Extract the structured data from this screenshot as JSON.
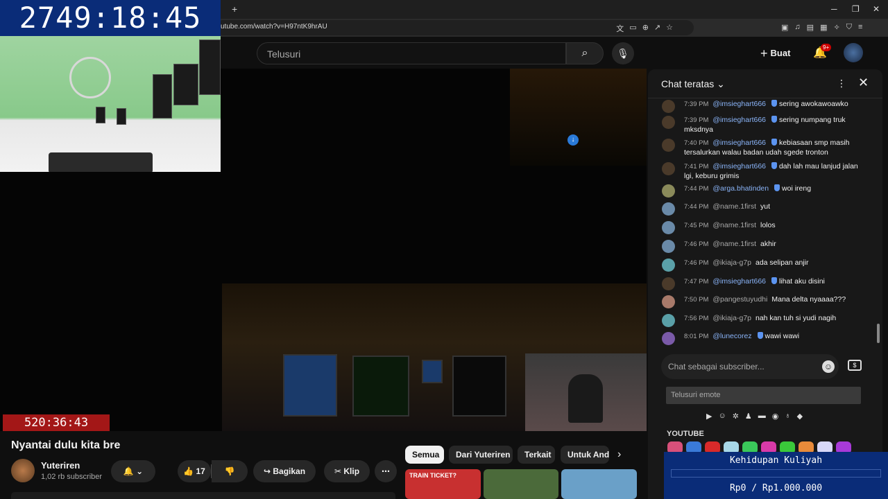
{
  "browser": {
    "new_tab": "+",
    "url": "utube.com/watch?v=H97ntK9hrAU",
    "window_min": "─",
    "window_max": "❐",
    "window_close": "✕"
  },
  "overlay": {
    "main_timer": "2749:18:45",
    "sub_timer": "520:36:43"
  },
  "header": {
    "search_placeholder": "Telusuri",
    "create_label": "Buat",
    "notification_badge": "9+"
  },
  "video": {
    "title": "Nyantai dulu kita bre",
    "channel_name": "Yuteriren",
    "channel_subs": "1,02 rb subscriber",
    "likes": "17",
    "share_label": "Bagikan",
    "clip_label": "Klip"
  },
  "chips": [
    "Semua",
    "Dari Yuteriren",
    "Terkait",
    "Untuk Anda"
  ],
  "thumbnails": [
    {
      "text": "TRAIN TICKET?",
      "color": "#c83030"
    },
    {
      "text": "",
      "color": "#4b6a3a"
    },
    {
      "text": "",
      "color": "#6aa0c8"
    }
  ],
  "chat": {
    "title": "Chat teratas",
    "input_placeholder": "Chat sebagai subscriber...",
    "emote_search_placeholder": "Telusuri emote",
    "emote_section": "YOUTUBE",
    "messages": [
      {
        "time": "7:39 PM",
        "author": "@imsieghart666",
        "member": true,
        "text": "sering awokawoawko",
        "avatar": "#4a3a2a"
      },
      {
        "time": "7:39 PM",
        "author": "@imsieghart666",
        "member": true,
        "text": "sering numpang truk mksdnya",
        "avatar": "#4a3a2a"
      },
      {
        "time": "7:40 PM",
        "author": "@imsieghart666",
        "member": true,
        "text": "kebiasaan smp masih tersalurkan walau badan udah sgede tronton",
        "avatar": "#4a3a2a"
      },
      {
        "time": "7:41 PM",
        "author": "@imsieghart666",
        "member": true,
        "text": "dah lah mau lanjud jalan lgi, keburu grimis",
        "avatar": "#4a3a2a"
      },
      {
        "time": "7:44 PM",
        "author": "@arga.bhatinden",
        "member": true,
        "text": "woi ireng",
        "avatar": "#8a8a5a"
      },
      {
        "time": "7:44 PM",
        "author": "@name.1first",
        "member": false,
        "text": "yut",
        "avatar": "#6a8aa8"
      },
      {
        "time": "7:45 PM",
        "author": "@name.1first",
        "member": false,
        "text": "lolos",
        "avatar": "#6a8aa8"
      },
      {
        "time": "7:46 PM",
        "author": "@name.1first",
        "member": false,
        "text": "akhir",
        "avatar": "#6a8aa8"
      },
      {
        "time": "7:46 PM",
        "author": "@ikiaja-g7p",
        "member": false,
        "text": "ada selipan anjir",
        "avatar": "#5aa0a8"
      },
      {
        "time": "7:47 PM",
        "author": "@imsieghart666",
        "member": true,
        "text": "lihat aku disini",
        "avatar": "#4a3a2a"
      },
      {
        "time": "7:50 PM",
        "author": "@pangestuyudhi",
        "member": false,
        "text": "Mana delta nyaaaa???",
        "avatar": "#a87a6a"
      },
      {
        "time": "7:56 PM",
        "author": "@ikiaja-g7p",
        "member": false,
        "text": "nah kan tuh si yudi nagih",
        "avatar": "#5aa0a8"
      },
      {
        "time": "8:01 PM",
        "author": "@lunecorez",
        "member": true,
        "text": "wawi wawi",
        "avatar": "#7a5aa8"
      }
    ]
  },
  "goal": {
    "title": "Kehidupan Kuliyah",
    "amount": "Rp0 / Rp1.000.000",
    "progress": 0
  }
}
